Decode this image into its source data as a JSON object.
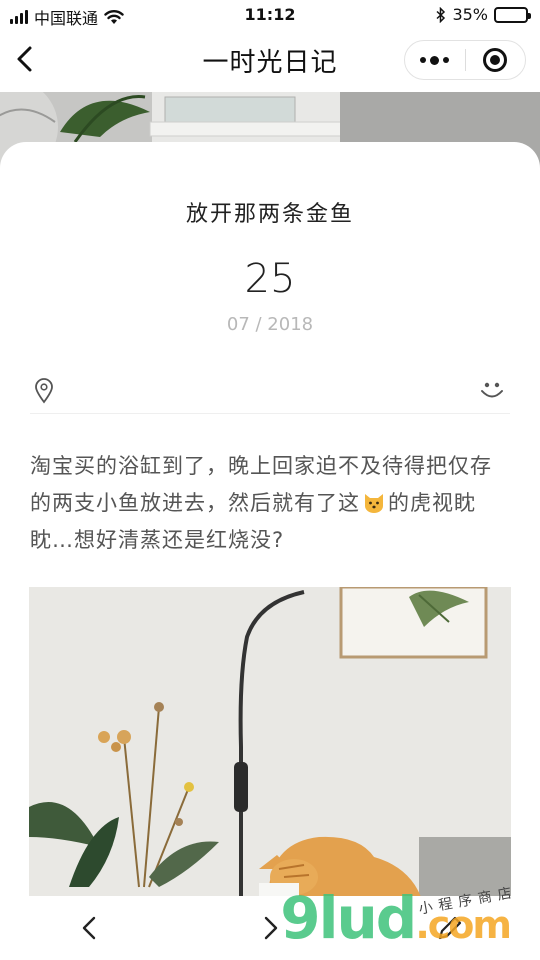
{
  "status_bar": {
    "carrier": "中国联通",
    "time": "11:12",
    "battery_percent": "35%",
    "battery_level": 0.35,
    "icons": [
      "signal-icon",
      "wifi-icon",
      "bluetooth-icon",
      "battery-icon"
    ]
  },
  "nav": {
    "title": "一时光日记",
    "back_icon": "chevron-left-icon",
    "more_icon": "more-dots-icon",
    "close_icon": "capsule-target-icon"
  },
  "entry": {
    "title": "放开那两条金鱼",
    "day": "25",
    "month_year": "07 / 2018",
    "location_icon": "location-pin-icon",
    "mood_icon": "smiley-icon",
    "body_part1": "淘宝买的浴缸到了，晚上回家迫不及待得把仅存的两支小鱼放进去，然后就有了这",
    "body_part2": "的虎视眈眈…想好清蒸还是红烧没?"
  },
  "toolbar": {
    "prev_icon": "chevron-left-icon",
    "next_icon": "chevron-right-icon",
    "edit_icon": "pencil-icon"
  },
  "watermark": {
    "main": "9lud",
    "suffix": ".com",
    "sub": "小程序商店"
  },
  "colors": {
    "accent_green": "#3ec27b",
    "accent_orange": "#f5a623",
    "text_muted": "#b8b8b8"
  }
}
